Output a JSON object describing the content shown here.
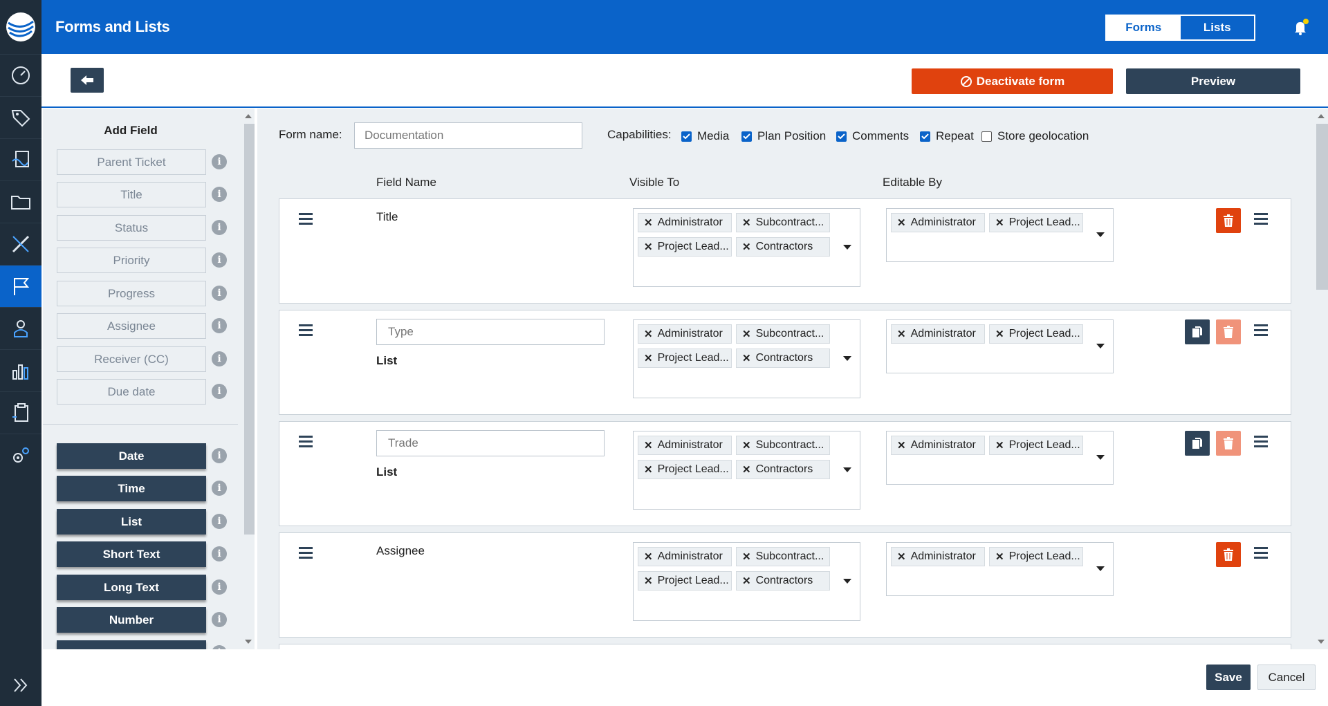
{
  "app": {
    "title": "Forms and Lists"
  },
  "header": {
    "toggle": {
      "forms": "Forms",
      "lists": "Lists",
      "active": "Forms"
    },
    "notification_dot_color": "#f5d000"
  },
  "colors": {
    "brand": "#0a63c9",
    "danger": "#e0420e",
    "navy": "#2e4358",
    "sidebar": "#1f2d3a"
  },
  "sidebar": {
    "items": [
      {
        "icon": "dashboard-gauge-icon"
      },
      {
        "icon": "tags-icon"
      },
      {
        "icon": "plans-documents-icon"
      },
      {
        "icon": "folder-icon"
      },
      {
        "icon": "measure-tools-icon"
      },
      {
        "icon": "flag-icon",
        "active": true
      },
      {
        "icon": "user-icon"
      },
      {
        "icon": "bar-chart-icon"
      },
      {
        "icon": "clipboard-icon"
      },
      {
        "icon": "settings-gears-icon"
      }
    ],
    "expand_icon": "double-chevron-right-icon"
  },
  "actions": {
    "back_icon": "arrow-left-icon",
    "deactivate_label": "Deactivate form",
    "preview_label": "Preview"
  },
  "field_panel": {
    "heading": "Add Field",
    "system_fields": [
      "Parent Ticket",
      "Title",
      "Status",
      "Priority",
      "Progress",
      "Assignee",
      "Receiver (CC)",
      "Due date"
    ],
    "custom_fields": [
      "Date",
      "Time",
      "List",
      "Short Text",
      "Long Text",
      "Number"
    ]
  },
  "form": {
    "name_label": "Form name:",
    "name_placeholder": "Documentation",
    "capabilities_label": "Capabilities:",
    "capabilities": [
      {
        "label": "Media",
        "checked": true
      },
      {
        "label": "Plan Position",
        "checked": true
      },
      {
        "label": "Comments",
        "checked": true
      },
      {
        "label": "Repeat",
        "checked": true
      },
      {
        "label": "Store geolocation",
        "checked": false
      }
    ],
    "columns": {
      "field_name": "Field Name",
      "visible_to": "Visible To",
      "editable_by": "Editable By"
    }
  },
  "rows": [
    {
      "field_name": "Title",
      "visible_to": [
        "Administrator",
        "Subcontract...",
        "Project Lead...",
        "Contractors"
      ],
      "editable_by": [
        "Administrator",
        "Project Lead..."
      ]
    },
    {
      "input_placeholder": "Type",
      "type_label": "List",
      "visible_to": [
        "Administrator",
        "Subcontract...",
        "Project Lead...",
        "Contractors"
      ],
      "editable_by": [
        "Administrator",
        "Project Lead..."
      ]
    },
    {
      "input_placeholder": "Trade",
      "type_label": "List",
      "visible_to": [
        "Administrator",
        "Subcontract...",
        "Project Lead...",
        "Contractors"
      ],
      "editable_by": [
        "Administrator",
        "Project Lead..."
      ]
    },
    {
      "field_name": "Assignee",
      "visible_to": [
        "Administrator",
        "Subcontract...",
        "Project Lead...",
        "Contractors"
      ],
      "editable_by": [
        "Administrator",
        "Project Lead..."
      ]
    }
  ],
  "footer": {
    "save_label": "Save",
    "cancel_label": "Cancel"
  }
}
